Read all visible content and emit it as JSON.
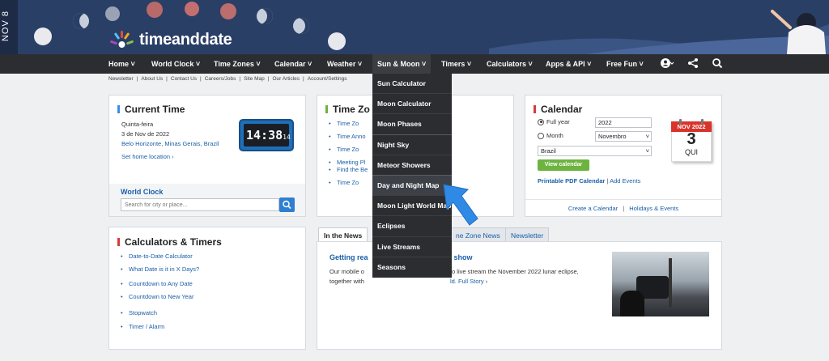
{
  "header": {
    "date_tab": "NOV 8",
    "logo_text": "timeanddate"
  },
  "nav": {
    "items": [
      "Home",
      "World Clock",
      "Time Zones",
      "Calendar",
      "Weather",
      "Sun & Moon",
      "Timers",
      "Calculators",
      "Apps & API",
      "Free Fun"
    ]
  },
  "sub_links": [
    "Newsletter",
    "About Us",
    "Contact Us",
    "Careers/Jobs",
    "Site Map",
    "Our Articles",
    "Account/Settings"
  ],
  "current_time": {
    "title": "Current Time",
    "day": "Quinta-feira",
    "date": "3 de Nov de 2022",
    "location": "Belo Horizonte, Minas Gerais, Brazil",
    "set_home": "Set home location",
    "clock_hm": "14:38",
    "clock_s": "14",
    "world_clock": "World Clock",
    "search_placeholder": "Search for city or place..."
  },
  "time_zones": {
    "title": "Time Zo",
    "items": [
      "Time Zo",
      "Time Anno",
      "Time Zo",
      "Meeting Pl",
      "Find the Be",
      "Time Zo"
    ]
  },
  "calendar": {
    "title": "Calendar",
    "full_year_label": "Full year",
    "full_year_value": "2022",
    "month_label": "Month",
    "month_value": "Novembro",
    "country_value": "Brazil",
    "view_btn": "View calendar",
    "pdf_link": "Printable PDF Calendar",
    "sep": "|",
    "add_events": "Add Events",
    "create_link": "Create a Calendar",
    "holidays_link": "Holidays & Events",
    "icon_month": "NOV 2022",
    "icon_day": "3",
    "icon_wd": "QUI"
  },
  "calculators": {
    "title": "Calculators & Timers",
    "items": [
      "Date-to-Date Calculator",
      "What Date is it in X Days?",
      "Countdown to Any Date",
      "Countdown to New Year",
      "Stopwatch",
      "Timer / Alarm"
    ]
  },
  "news": {
    "tabs": [
      "In the News",
      "ne Zone News",
      "Newsletter"
    ],
    "headline_start": "Getting rea",
    "headline_end": "show",
    "body_start": "Our mobile o",
    "body_end": "to live stream the November 2022 lunar eclipse,",
    "body_line2_start": "together with",
    "body_line2_end": "ld. Full Story"
  },
  "dropdown": {
    "items": [
      "Sun Calculator",
      "Moon Calculator",
      "Moon Phases",
      "Night Sky",
      "Meteor Showers",
      "Day and Night Map",
      "Moon Light World Map",
      "Eclipses",
      "Live Streams",
      "Seasons"
    ]
  },
  "colors": {
    "header": "#2a3f66",
    "nav": "#2b2d30",
    "accent_blue": "#1a5fa8",
    "arrow": "#2f8ae6",
    "green": "#6db33f",
    "red": "#c0392b"
  }
}
